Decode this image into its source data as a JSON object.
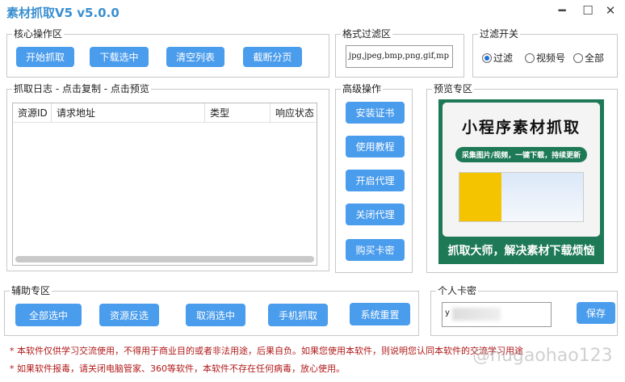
{
  "window": {
    "title": "素材抓取V5 v5.0.0",
    "minimize": "━",
    "maximize": "☐",
    "close": "✕"
  },
  "core": {
    "label": "核心操作区",
    "buttons": [
      "开始抓取",
      "下载选中",
      "清空列表",
      "截断分页"
    ]
  },
  "log": {
    "label": "抓取日志 - 点击复制 - 点击预览",
    "columns": [
      "资源ID",
      "请求地址",
      "类型",
      "响应状态"
    ]
  },
  "format": {
    "label": "格式过滤区",
    "value": "jpg,jpeg,bmp,png,gif,mp"
  },
  "filter": {
    "label": "过滤开关",
    "options": [
      "过滤",
      "视频号",
      "全部"
    ],
    "selected": "过滤"
  },
  "advanced": {
    "label": "高级操作",
    "buttons": [
      "安装证书",
      "使用教程",
      "开启代理",
      "关闭代理",
      "购买卡密"
    ]
  },
  "preview": {
    "label": "预览专区",
    "headline": "小程序素材抓取",
    "tagline": "采集图片/视频，一键下载，持续更新",
    "footer": "抓取大师，解决素材下载烦恼"
  },
  "aux": {
    "label": "辅助专区",
    "buttons": [
      "全部选中",
      "资源反选",
      "取消选中",
      "手机抓取",
      "系统重置"
    ]
  },
  "card": {
    "label": "个人卡密",
    "value": "y",
    "save": "保存"
  },
  "notes": [
    "* 本软件仅供学习交流使用，不得用于商业目的或者非法用途，后果自负。如果您使用本软件，则说明您认同本软件的交流学习用途",
    "* 如果软件报毒，请关闭电脑管家、360等软件，本软件不存在任何病毒，放心使用。"
  ],
  "watermark": "@hugaohao123",
  "colors": {
    "button": "#4a9cec",
    "title": "#3a8fd0",
    "note": "#b01818",
    "poster": "#1e7a56"
  }
}
